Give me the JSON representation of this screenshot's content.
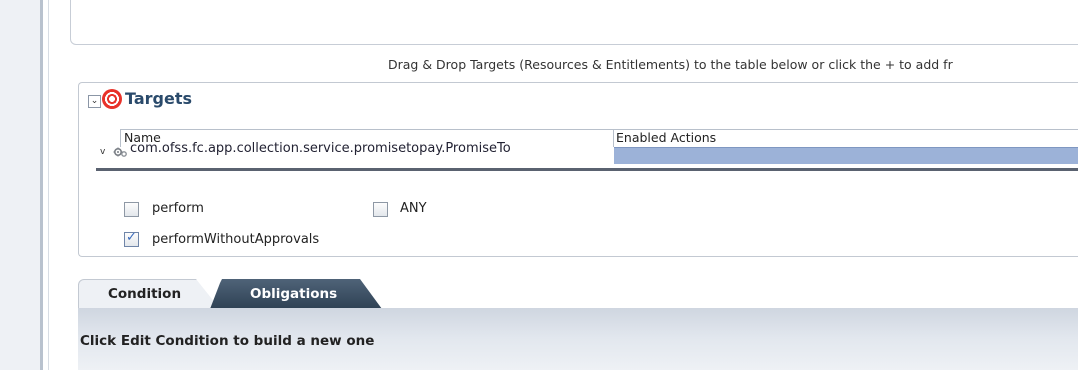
{
  "hint": "Drag & Drop Targets (Resources & Entitlements) to the table below or click the + to add fr",
  "targets": {
    "title": "Targets",
    "columns": [
      "Name",
      "Enabled Actions"
    ],
    "row": {
      "name": "com.ofss.fc.app.collection.service.promisetopay.PromiseTo",
      "icon": "gear-icon"
    }
  },
  "actions": [
    {
      "label": "perform",
      "checked": false
    },
    {
      "label": "ANY",
      "checked": false
    },
    {
      "label": "performWithoutApprovals",
      "checked": true
    }
  ],
  "tabs": [
    {
      "label": "Condition",
      "active": true
    },
    {
      "label": "Obligations",
      "active": false
    }
  ],
  "condition_message": "Click Edit Condition to build a new one",
  "colors": {
    "selected_row": "#9cb2d8",
    "tab_dark": "#3b4f63",
    "title": "#2a4a6b",
    "accent_icon": "#e8322a"
  }
}
